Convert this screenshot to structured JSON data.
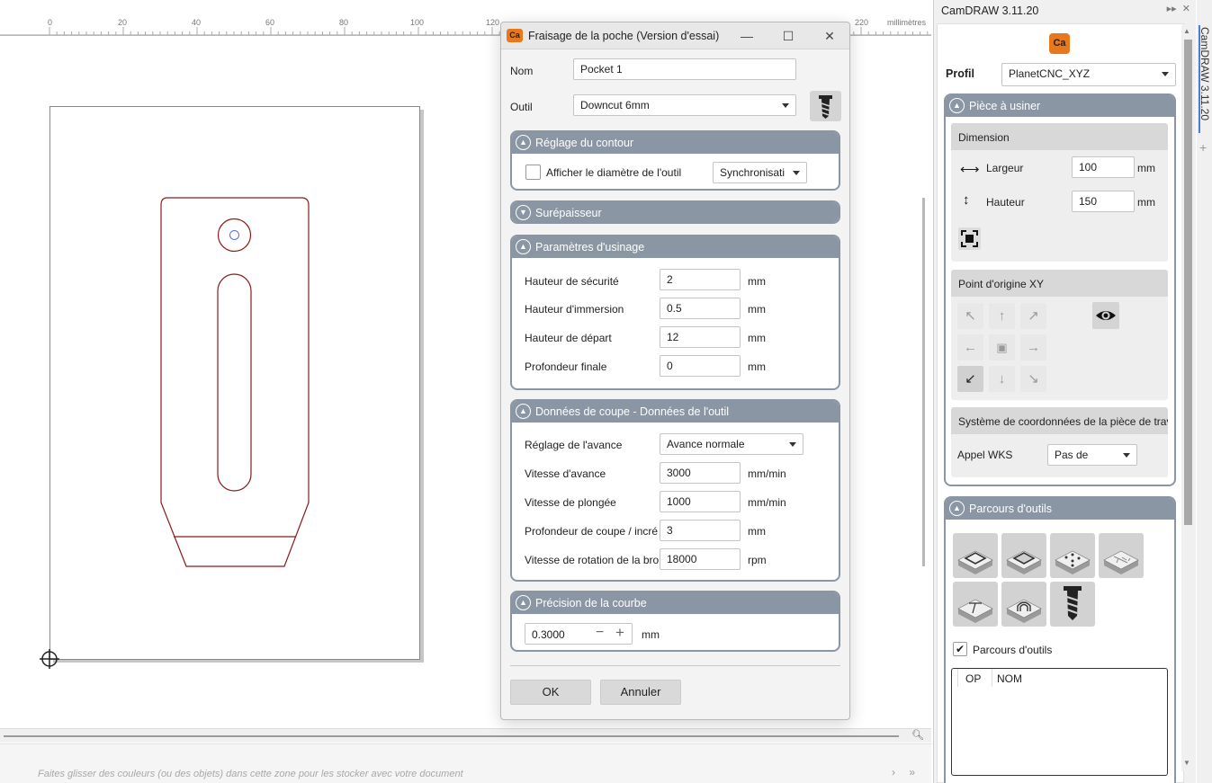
{
  "ruler": {
    "ticks": [
      "0",
      "20",
      "40",
      "60",
      "80",
      "100",
      "120",
      "220"
    ],
    "unit": "millimètres"
  },
  "statusbar": {
    "hint": "Faites glisser des couleurs (ou des objets) dans cette zone pour les stocker avec votre document",
    "nav": "› »"
  },
  "dialog": {
    "icon_text": "Ca",
    "title": "Fraisage de la poche (Version d'essai)",
    "nom_label": "Nom",
    "nom_value": "Pocket 1",
    "outil_label": "Outil",
    "outil_value": "Downcut 6mm",
    "contour": {
      "title": "Réglage du contour",
      "checkbox_label": "Afficher le diamètre de l'outil",
      "sync_value": "Synchronisati"
    },
    "surepaisseur": {
      "title": "Surépaisseur"
    },
    "params": {
      "title": "Paramètres d'usinage",
      "rows": [
        {
          "label": "Hauteur de sécurité",
          "value": "2",
          "unit": "mm"
        },
        {
          "label": "Hauteur d'immersion",
          "value": "0.5",
          "unit": "mm"
        },
        {
          "label": "Hauteur de départ",
          "value": "12",
          "unit": "mm"
        },
        {
          "label": "Profondeur finale",
          "value": "0",
          "unit": "mm"
        }
      ]
    },
    "coupe": {
      "title": "Données de coupe - Données de l'outil",
      "avance_label": "Réglage de l'avance",
      "avance_value": "Avance normale",
      "rows": [
        {
          "label": "Vitesse d'avance",
          "value": "3000",
          "unit": "mm/min"
        },
        {
          "label": "Vitesse de plongée",
          "value": "1000",
          "unit": "mm/min"
        },
        {
          "label": "Profondeur de coupe / incré",
          "value": "3",
          "unit": "mm"
        },
        {
          "label": "Vitesse de rotation de la bro",
          "value": "18000",
          "unit": "rpm"
        }
      ]
    },
    "precision": {
      "title": "Précision de la courbe",
      "value": "0.3000",
      "unit": "mm"
    },
    "ok_label": "OK",
    "cancel_label": "Annuler"
  },
  "rpanel": {
    "title": "CamDRAW 3.11.20",
    "tab_label": "CamDRAW 3.11.20",
    "logo_text": "Ca",
    "profil_label": "Profil",
    "profil_value": "PlanetCNC_XYZ",
    "piece": {
      "title": "Pièce à usiner",
      "dimension_title": "Dimension",
      "largeur_label": "Largeur",
      "largeur_value": "100",
      "hauteur_label": "Hauteur",
      "hauteur_value": "150",
      "unit": "mm",
      "origin_title": "Point d'origine XY",
      "coord_title": "Système de coordonnées de la pièce de trav",
      "wks_label": "Appel WKS",
      "wks_value": "Pas de"
    },
    "parcours": {
      "title": "Parcours d'outils",
      "checkbox_label": "Parcours d'outils",
      "col_op": "OP",
      "col_nom": "NOM"
    }
  },
  "colors": {
    "group_header": "#8a96a3",
    "drawing_stroke": "#8b1a1a",
    "hole_inner": "#5a6fd6",
    "accent_orange": "#e9781c",
    "tab_accent": "#4c7bd8"
  }
}
